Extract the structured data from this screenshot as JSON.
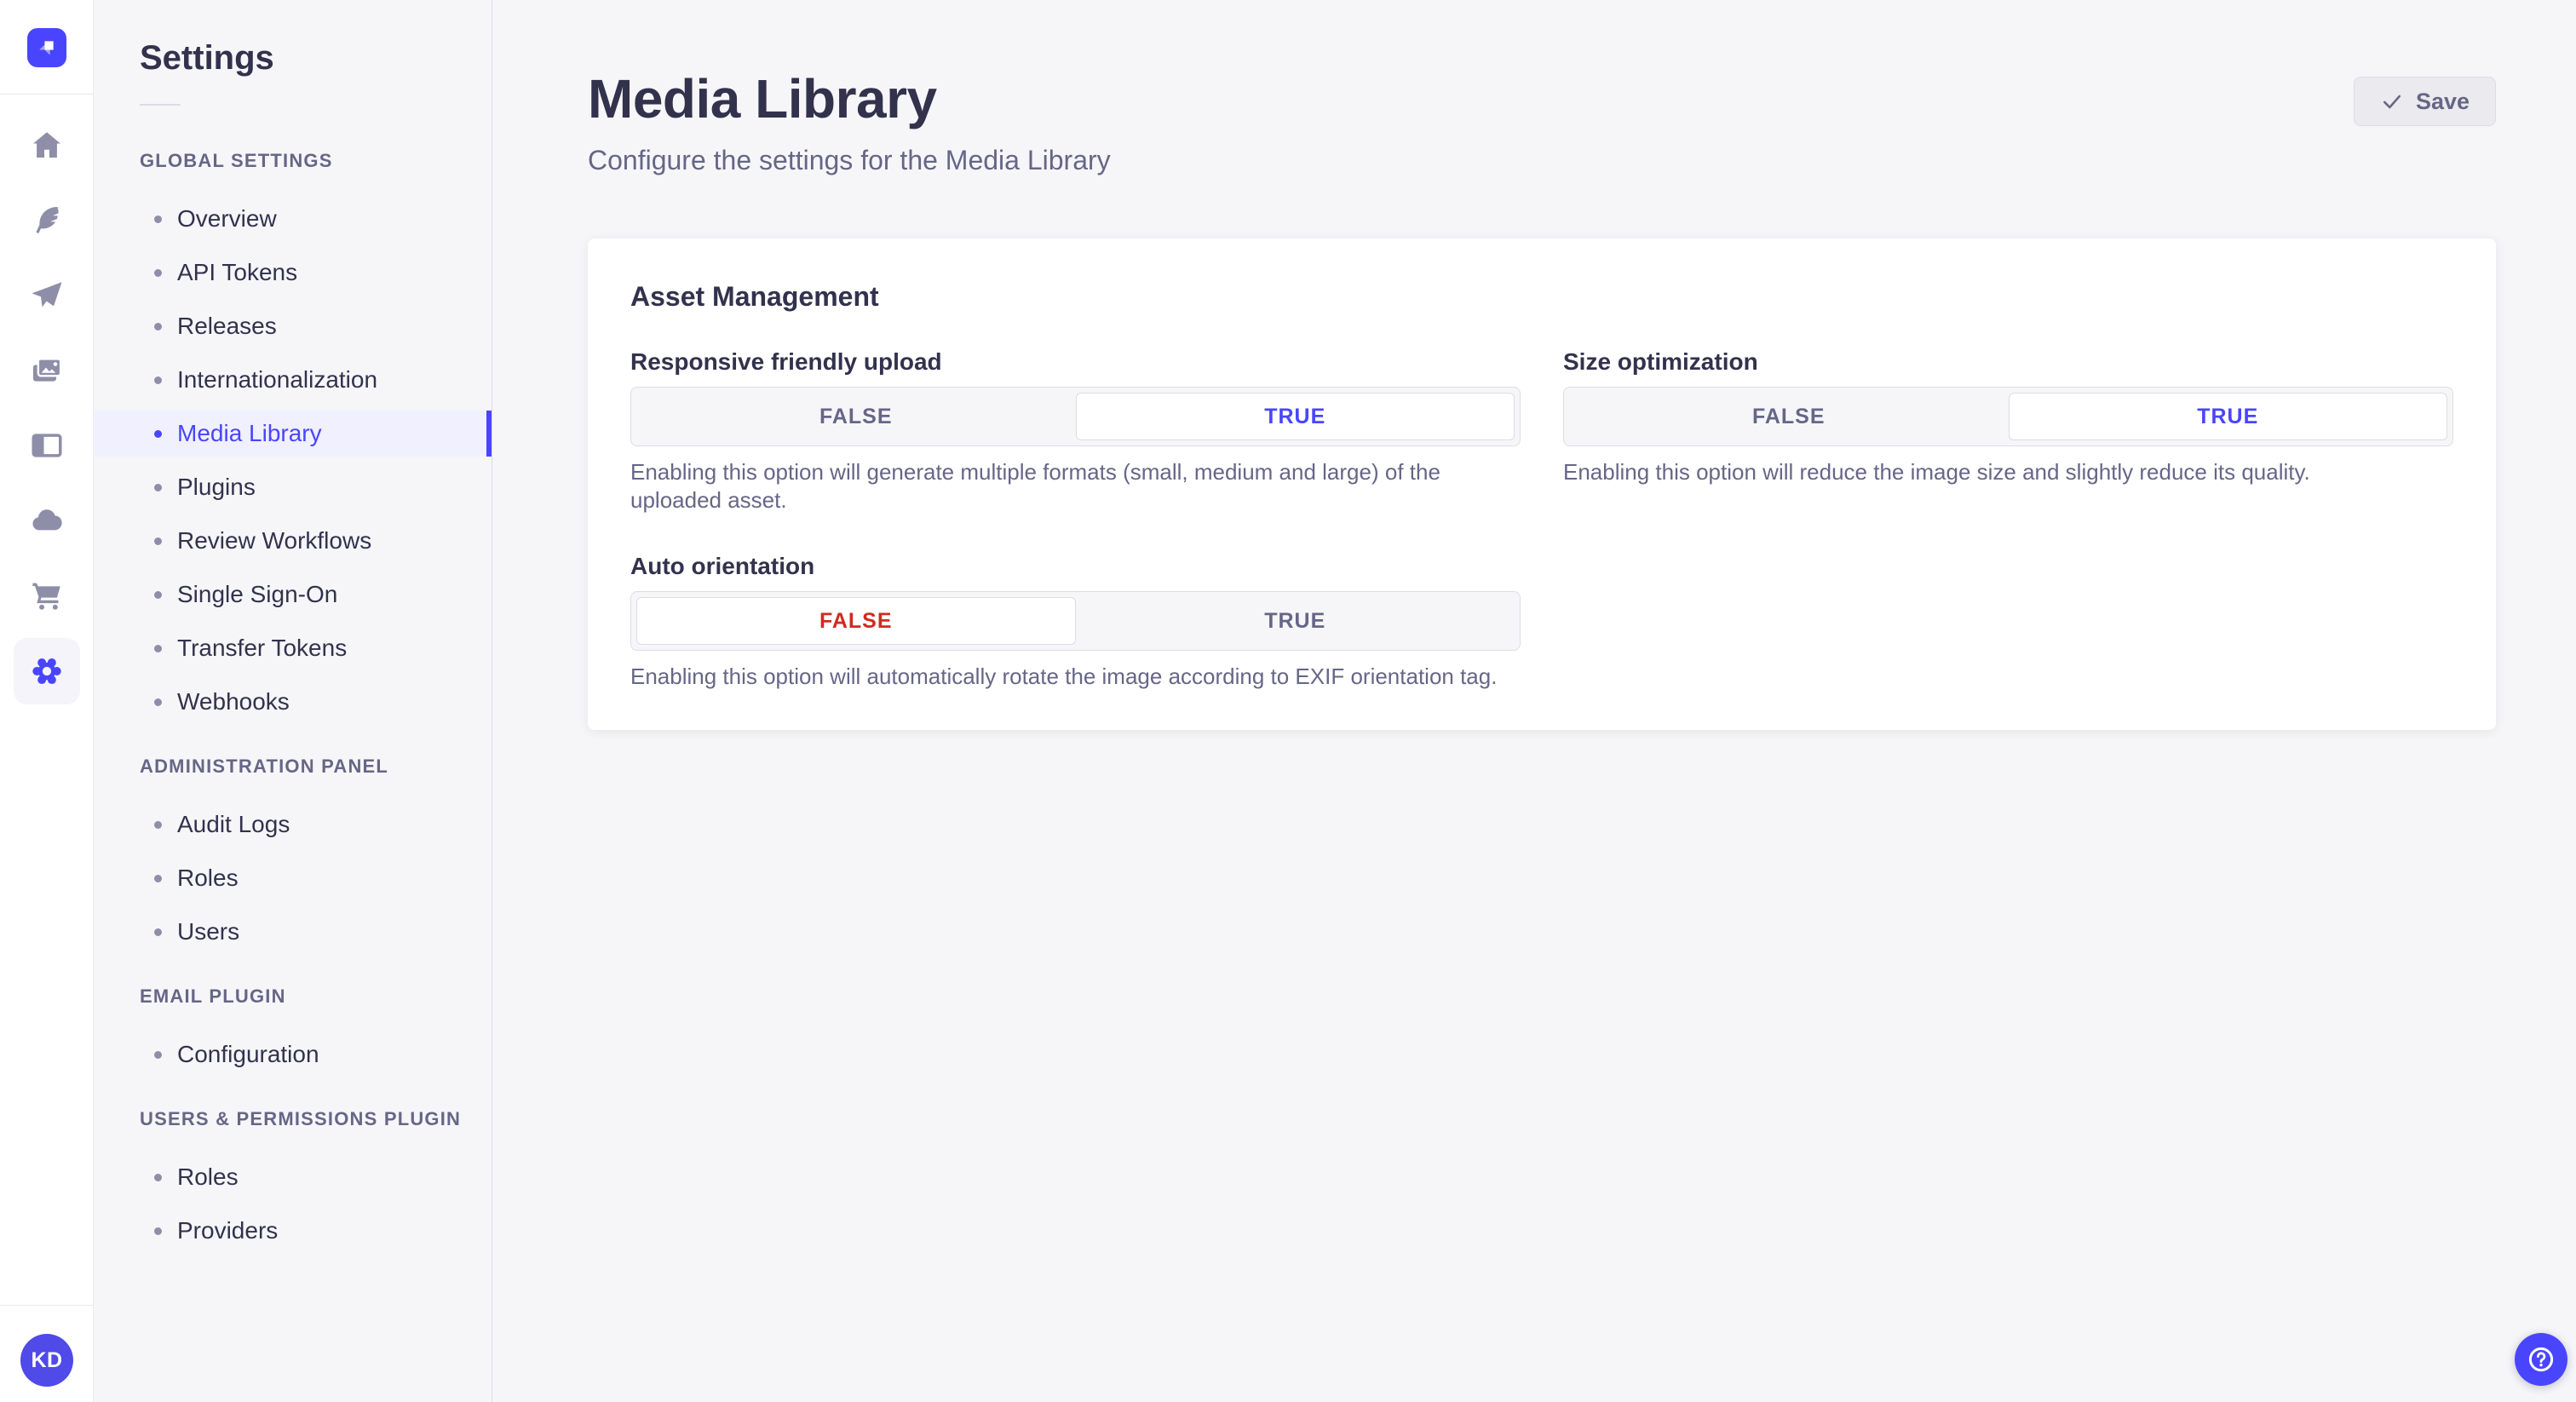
{
  "rail": {
    "icons": [
      {
        "name": "home-icon",
        "active": false
      },
      {
        "name": "feather-icon",
        "active": false
      },
      {
        "name": "send-icon",
        "active": false
      },
      {
        "name": "images-icon",
        "active": false
      },
      {
        "name": "layout-icon",
        "active": false
      },
      {
        "name": "cloud-icon",
        "active": false
      },
      {
        "name": "cart-icon",
        "active": false
      },
      {
        "name": "settings-gear-icon",
        "active": true
      }
    ]
  },
  "avatar": {
    "initials": "KD"
  },
  "sidebar": {
    "title": "Settings",
    "sections": [
      {
        "label": "GLOBAL SETTINGS",
        "items": [
          {
            "label": "Overview",
            "active": false
          },
          {
            "label": "API Tokens",
            "active": false
          },
          {
            "label": "Releases",
            "active": false
          },
          {
            "label": "Internationalization",
            "active": false
          },
          {
            "label": "Media Library",
            "active": true
          },
          {
            "label": "Plugins",
            "active": false
          },
          {
            "label": "Review Workflows",
            "active": false
          },
          {
            "label": "Single Sign-On",
            "active": false
          },
          {
            "label": "Transfer Tokens",
            "active": false
          },
          {
            "label": "Webhooks",
            "active": false
          }
        ]
      },
      {
        "label": "ADMINISTRATION PANEL",
        "items": [
          {
            "label": "Audit Logs",
            "active": false
          },
          {
            "label": "Roles",
            "active": false
          },
          {
            "label": "Users",
            "active": false
          }
        ]
      },
      {
        "label": "EMAIL PLUGIN",
        "items": [
          {
            "label": "Configuration",
            "active": false
          }
        ]
      },
      {
        "label": "USERS & PERMISSIONS PLUGIN",
        "items": [
          {
            "label": "Roles",
            "active": false
          },
          {
            "label": "Providers",
            "active": false
          }
        ]
      }
    ]
  },
  "header": {
    "title": "Media Library",
    "subtitle": "Configure the settings for the Media Library",
    "save_label": "Save"
  },
  "card": {
    "title": "Asset Management",
    "fields": [
      {
        "label": "Responsive friendly upload",
        "options": [
          "FALSE",
          "TRUE"
        ],
        "selected": 1,
        "hint": "Enabling this option will generate multiple formats (small, medium and large) of the uploaded asset."
      },
      {
        "label": "Size optimization",
        "options": [
          "FALSE",
          "TRUE"
        ],
        "selected": 1,
        "hint": "Enabling this option will reduce the image size and slightly reduce its quality."
      },
      {
        "label": "Auto orientation",
        "options": [
          "FALSE",
          "TRUE"
        ],
        "selected": 0,
        "hint": "Enabling this option will automatically rotate the image according to EXIF orientation tag."
      }
    ]
  },
  "colors": {
    "primary": "#4945ff",
    "primary_light": "#f0f0ff",
    "danger": "#d02b20",
    "text_dark": "#32324d",
    "text_muted": "#666687"
  }
}
